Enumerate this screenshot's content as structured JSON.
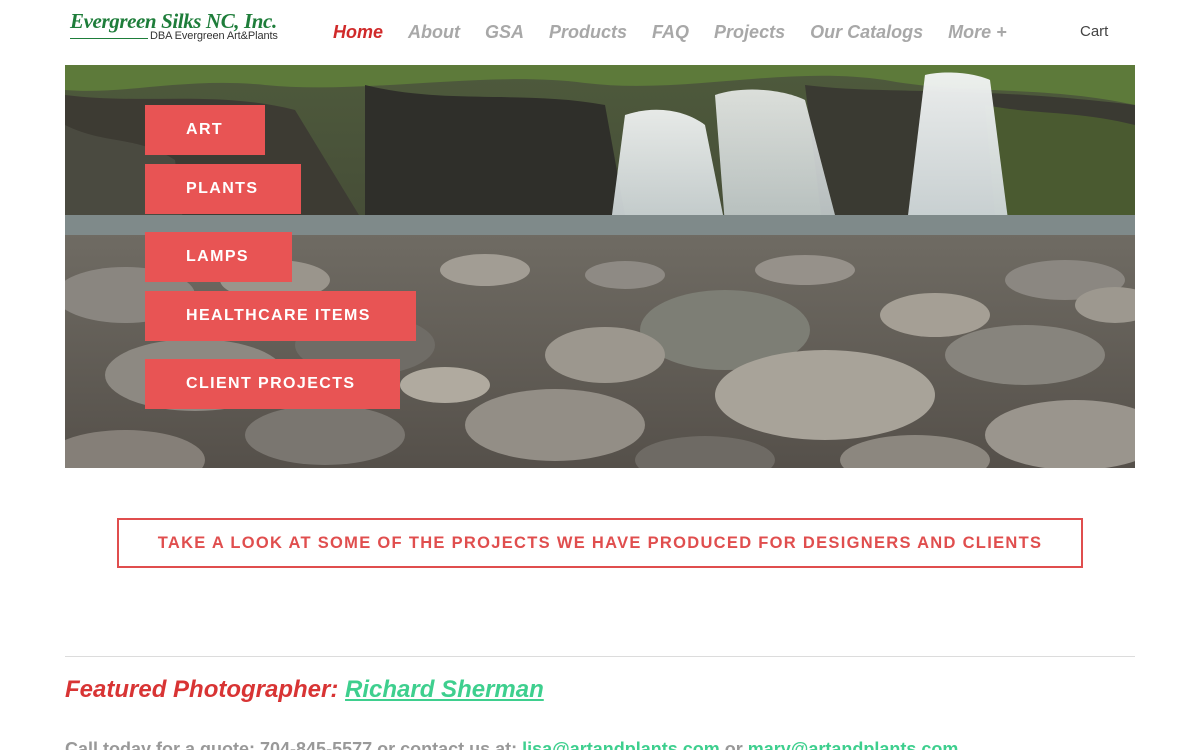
{
  "header": {
    "logo_title": "Evergreen Silks NC, Inc.",
    "logo_subtitle": "DBA Evergreen Art&Plants",
    "nav": [
      "Home",
      "About",
      "GSA",
      "Products",
      "FAQ",
      "Projects",
      "Our Catalogs",
      "More +"
    ],
    "active_nav": "Home",
    "cart_label": "Cart"
  },
  "hero": {
    "categories": [
      "ART",
      "PLANTS",
      "LAMPS",
      "HEALTHCARE ITEMS",
      "CLIENT PROJECTS"
    ]
  },
  "cta": {
    "label": "TAKE A LOOK AT SOME OF THE PROJECTS WE HAVE PRODUCED FOR DESIGNERS AND CLIENTS"
  },
  "featured": {
    "label": "Featured Photographer: ",
    "name": "Richard Sherman"
  },
  "contact": {
    "prefix": "Call today for a quote: 704-845-5577 or contact us at: ",
    "email_1": "lisa@artandplants.com",
    "joiner": " or ",
    "email_2": "mary@artandplants.com"
  },
  "colors": {
    "accent_red": "#e85454",
    "nav_active": "#d02a2a",
    "link_green": "#3ecf8e",
    "logo_green": "#1e7d3a"
  }
}
